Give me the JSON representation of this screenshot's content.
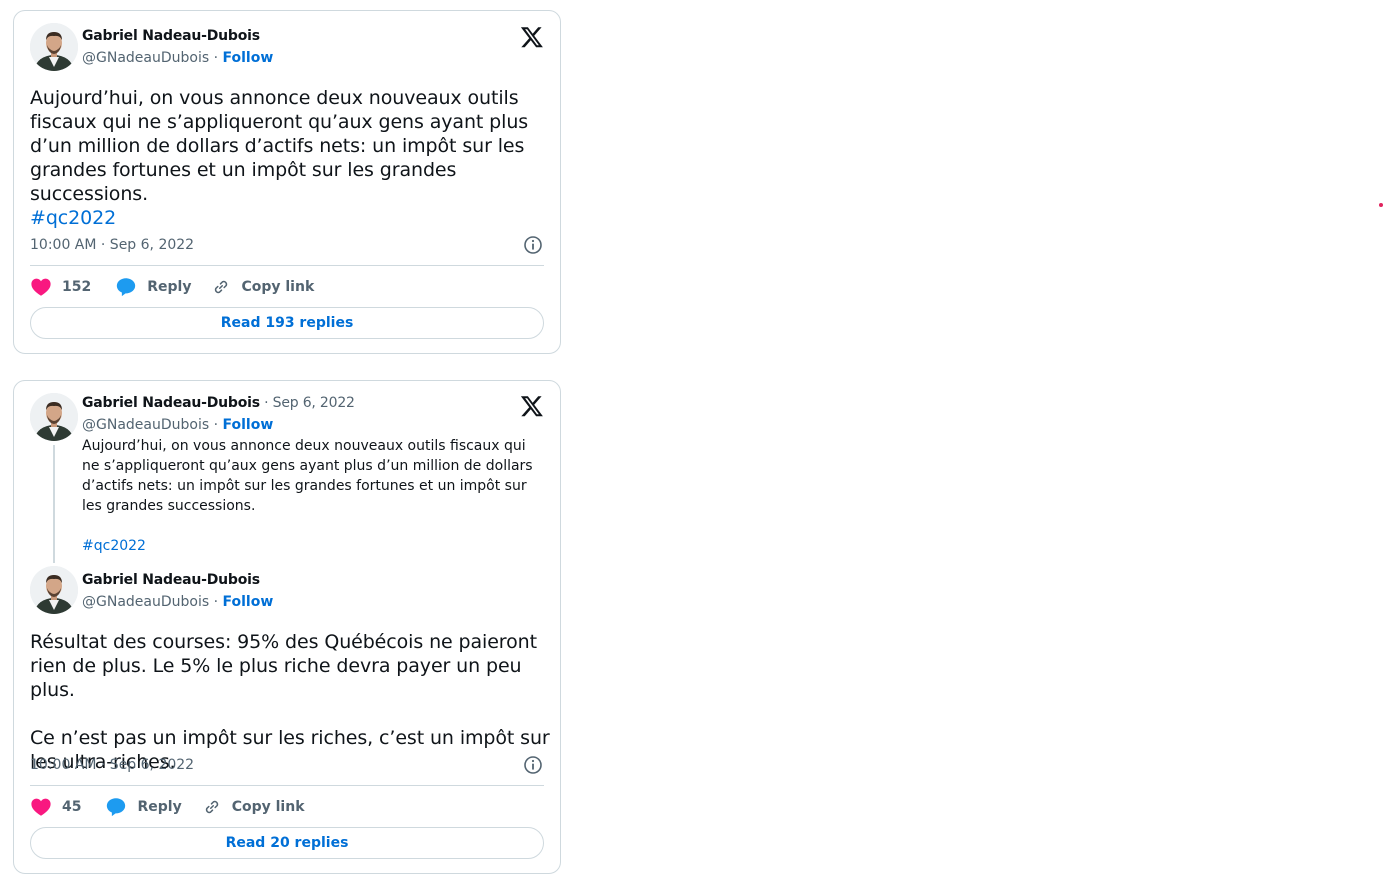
{
  "tweet1": {
    "author_name": "Gabriel Nadeau-Dubois",
    "handle": "@GNadeauDubois",
    "separator": " · ",
    "follow_label": "Follow",
    "body": "Aujourd’hui, on vous annonce deux nouveaux outils fiscaux qui ne s’appliqueront qu’aux gens ayant plus d’un million de dollars d’actifs nets: un impôt sur les grandes fortunes et un impôt sur les grandes successions.",
    "hashtag": "#qc2022",
    "timestamp": "10:00 AM · Sep 6, 2022",
    "like_count": "152",
    "reply_label": "Reply",
    "copy_link_label": "Copy link",
    "read_replies_label": "Read 193 replies"
  },
  "tweet2": {
    "quoted": {
      "author_name": "Gabriel Nadeau-Dubois",
      "date": "Sep 6, 2022",
      "handle": "@GNadeauDubois",
      "follow_label": "Follow",
      "body": "Aujourd’hui, on vous annonce deux nouveaux outils fiscaux qui ne s’appliqueront qu’aux gens ayant plus d’un million de dollars d’actifs nets: un impôt sur les grandes fortunes et un impôt sur les grandes successions.",
      "hashtag": "#qc2022"
    },
    "author_name": "Gabriel Nadeau-Dubois",
    "handle": "@GNadeauDubois",
    "follow_label": "Follow",
    "body": "Résultat des courses: 95% des Québécois ne paieront rien de plus. Le 5% le plus riche devra payer un peu plus.\n\nCe n’est pas un impôt sur les riches, c’est un impôt sur les ultra-riches.",
    "timestamp": "10:00 AM · Sep 6, 2022",
    "like_count": "45",
    "reply_label": "Reply",
    "copy_link_label": "Copy link",
    "read_replies_label": "Read 20 replies"
  },
  "colors": {
    "link": "#006fd6",
    "like": "#f91880",
    "reply": "#1d9bf0",
    "muted": "#536471",
    "border": "#cfd9de"
  },
  "icons": [
    "x-logo-icon",
    "info-icon",
    "heart-icon",
    "speech-bubble-icon",
    "link-icon"
  ]
}
